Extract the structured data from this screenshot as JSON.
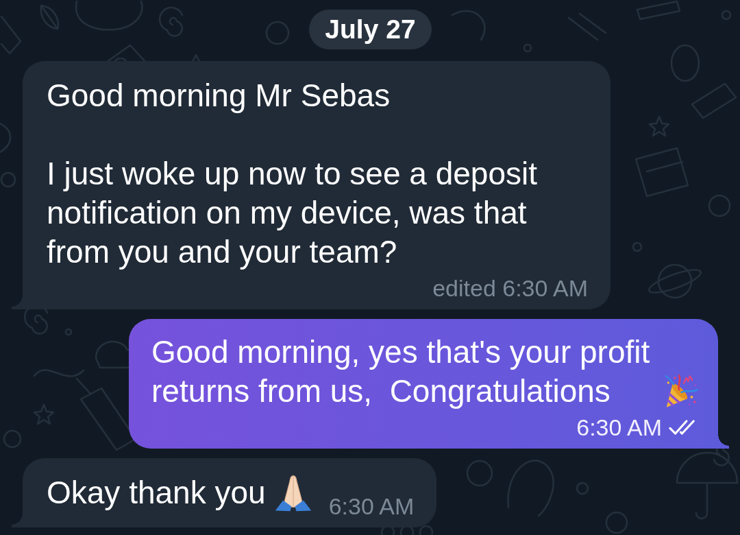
{
  "date_badge": {
    "label": "July 27"
  },
  "messages": [
    {
      "kind": "incoming",
      "text": "Good morning Mr Sebas\n\nI just woke up now to see a deposit notification on my device, was that from you and your team?",
      "timestamp": "edited 6:30 AM"
    },
    {
      "kind": "outgoing",
      "text": "Good morning, yes that's your profit returns from us,  Congratulations",
      "timestamp": "6:30 AM",
      "read": true
    },
    {
      "kind": "incoming",
      "text": "Okay thank you",
      "timestamp": "6:30 AM"
    }
  ]
}
